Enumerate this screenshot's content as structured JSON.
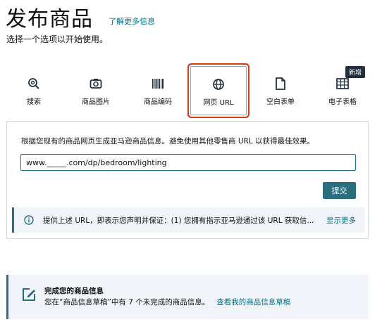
{
  "header": {
    "title": "发布商品",
    "learn_more": "了解更多信息",
    "subtitle": "选择一个选项以开始使用。"
  },
  "options": [
    {
      "label": "搜索",
      "icon": "search-icon"
    },
    {
      "label": "商品图片",
      "icon": "camera-icon"
    },
    {
      "label": "商品编码",
      "icon": "barcode-icon"
    },
    {
      "label": "网页 URL",
      "icon": "globe-icon",
      "selected": true
    },
    {
      "label": "空白表单",
      "icon": "document-icon"
    },
    {
      "label": "电子表格",
      "icon": "spreadsheet-icon",
      "badge": "新增"
    }
  ],
  "url_panel": {
    "description": "根据您现有的商品网页生成亚马逊商品信息。避免使用其他零售商 URL 以获得最佳效果。",
    "url_value": "www._____.com/dp/bedroom/lighting",
    "submit_label": "提交",
    "notice_text": "提供上述 URL，即表示您声明并保证：(1) 您拥有指示亚马逊通过该 URL 获取信...",
    "notice_more": "显示更多"
  },
  "draft": {
    "heading": "完成您的商品信息",
    "body": "您在“商品信息草稿”中有 7 个未完成的商品信息。",
    "link": "查看我的商品信息草稿"
  },
  "colors": {
    "accent": "#2b6e80",
    "link": "#007185",
    "highlight": "#d7391f",
    "badge": "#232f3e"
  }
}
